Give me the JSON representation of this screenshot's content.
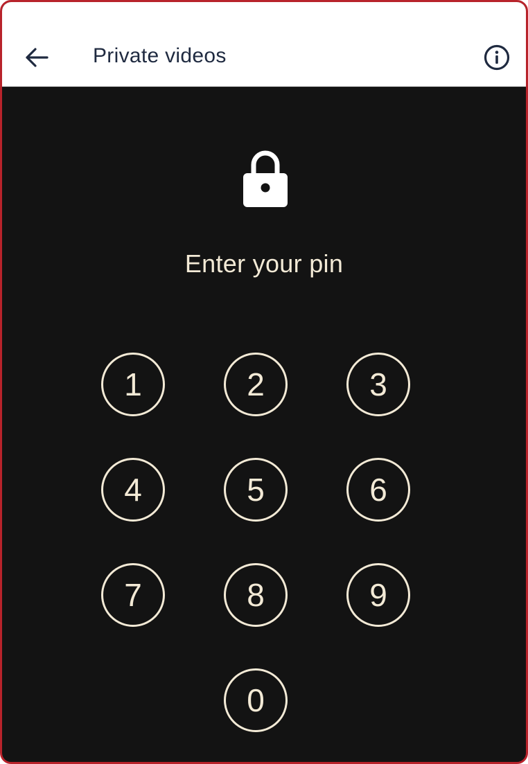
{
  "header": {
    "title": "Private videos",
    "back_icon": "arrow-left-icon",
    "info_icon": "info-icon"
  },
  "main": {
    "lock_icon": "lock-icon",
    "prompt": "Enter your pin"
  },
  "keypad": {
    "keys": [
      "1",
      "2",
      "3",
      "4",
      "5",
      "6",
      "7",
      "8",
      "9",
      "0"
    ]
  },
  "colors": {
    "frame_border": "#b8232b",
    "background": "#131313",
    "header_bg": "#ffffff",
    "header_text": "#1f2a40",
    "foreground": "#f3ead6"
  }
}
